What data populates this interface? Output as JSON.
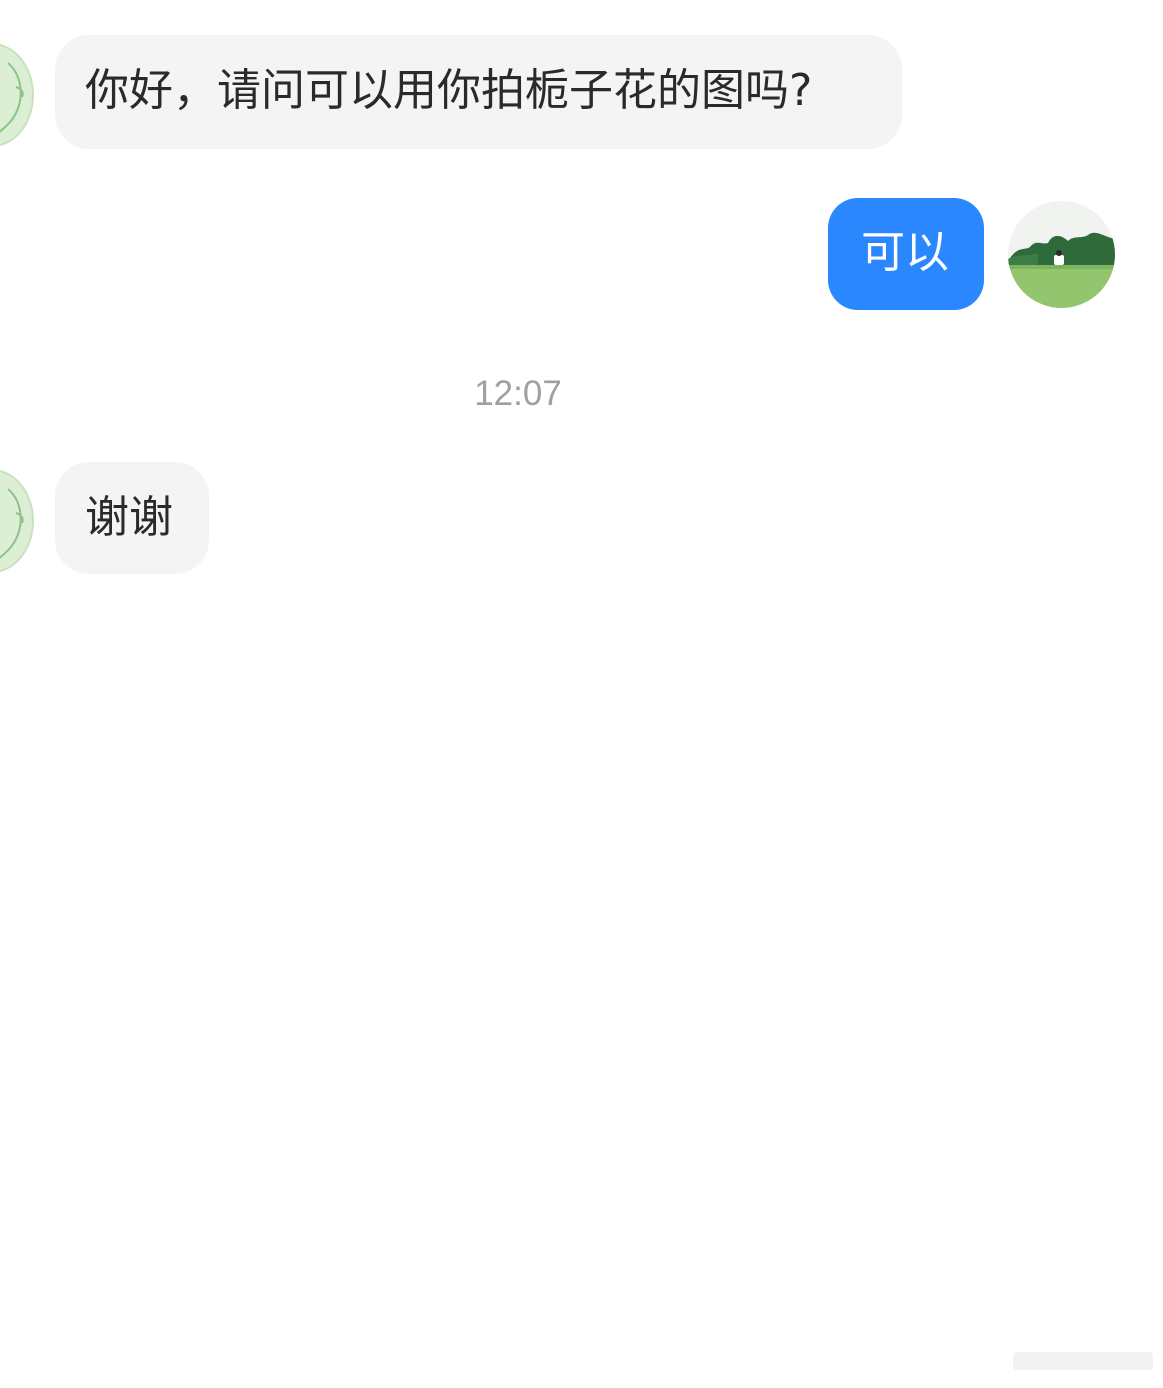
{
  "conversation": {
    "messages": [
      {
        "direction": "incoming",
        "text": "你好，请问可以用你拍栀子花的图吗?"
      },
      {
        "direction": "outgoing",
        "text": "可以"
      },
      {
        "direction": "incoming",
        "text": "谢谢"
      }
    ],
    "timestamp": "12:07"
  },
  "colors": {
    "incoming_bubble": "#f4f4f4",
    "outgoing_bubble": "#2b87fd",
    "timestamp_text": "#a0a0a0",
    "avatar_left_fill": "#dcefd4"
  },
  "icons": {
    "contact_avatar": "green-line-drawing-avatar",
    "own_avatar": "grass-field-photo-avatar"
  }
}
